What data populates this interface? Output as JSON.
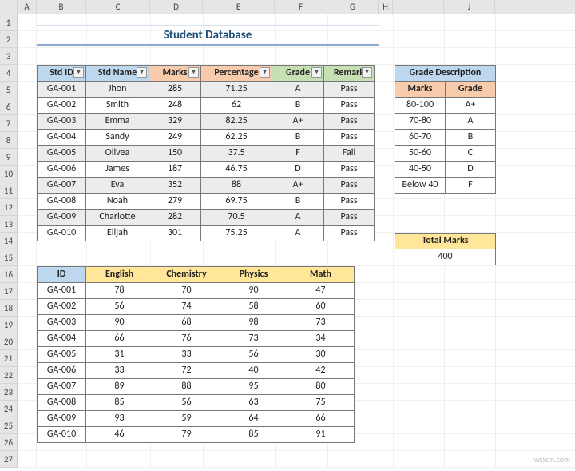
{
  "title": "Student Database",
  "columns_letters": [
    "A",
    "B",
    "C",
    "D",
    "E",
    "F",
    "G",
    "H",
    "I",
    "J"
  ],
  "main_table": {
    "headers": [
      "Std ID",
      "Std Name",
      "Marks",
      "Percentage",
      "Grade",
      "Remark"
    ],
    "rows": [
      {
        "id": "GA-001",
        "name": "Jhon",
        "marks": "285",
        "pct": "71.25",
        "grade": "A",
        "remark": "Pass"
      },
      {
        "id": "GA-002",
        "name": "Smith",
        "marks": "248",
        "pct": "62",
        "grade": "B",
        "remark": "Pass"
      },
      {
        "id": "GA-003",
        "name": "Emma",
        "marks": "329",
        "pct": "82.25",
        "grade": "A+",
        "remark": "Pass"
      },
      {
        "id": "GA-004",
        "name": "Sandy",
        "marks": "249",
        "pct": "62.25",
        "grade": "B",
        "remark": "Pass"
      },
      {
        "id": "GA-005",
        "name": "Olivea",
        "marks": "150",
        "pct": "37.5",
        "grade": "F",
        "remark": "Fail"
      },
      {
        "id": "GA-006",
        "name": "James",
        "marks": "187",
        "pct": "46.75",
        "grade": "D",
        "remark": "Pass"
      },
      {
        "id": "GA-007",
        "name": "Eva",
        "marks": "352",
        "pct": "88",
        "grade": "A+",
        "remark": "Pass"
      },
      {
        "id": "GA-008",
        "name": "Noah",
        "marks": "279",
        "pct": "69.75",
        "grade": "B",
        "remark": "Pass"
      },
      {
        "id": "GA-009",
        "name": "Charlotte",
        "marks": "282",
        "pct": "70.5",
        "grade": "A",
        "remark": "Pass"
      },
      {
        "id": "GA-010",
        "name": "Elijah",
        "marks": "301",
        "pct": "75.25",
        "grade": "A",
        "remark": "Pass"
      }
    ]
  },
  "grade_table": {
    "title": "Grade Description",
    "headers": [
      "Marks",
      "Grade"
    ],
    "rows": [
      {
        "m": "80-100",
        "g": "A+"
      },
      {
        "m": "70-80",
        "g": "A"
      },
      {
        "m": "60-70",
        "g": "B"
      },
      {
        "m": "50-60",
        "g": "C"
      },
      {
        "m": "40-50",
        "g": "D"
      },
      {
        "m": "Below 40",
        "g": "F"
      }
    ]
  },
  "total_marks": {
    "label": "Total Marks",
    "value": "400"
  },
  "subjects_table": {
    "headers": [
      "ID",
      "English",
      "Chemistry",
      "Physics",
      "Math"
    ],
    "rows": [
      {
        "id": "GA-001",
        "e": "78",
        "c": "70",
        "p": "90",
        "m": "47"
      },
      {
        "id": "GA-002",
        "e": "56",
        "c": "74",
        "p": "58",
        "m": "60"
      },
      {
        "id": "GA-003",
        "e": "90",
        "c": "68",
        "p": "98",
        "m": "73"
      },
      {
        "id": "GA-004",
        "e": "66",
        "c": "76",
        "p": "73",
        "m": "34"
      },
      {
        "id": "GA-005",
        "e": "31",
        "c": "33",
        "p": "56",
        "m": "30"
      },
      {
        "id": "GA-006",
        "e": "33",
        "c": "72",
        "p": "40",
        "m": "42"
      },
      {
        "id": "GA-007",
        "e": "89",
        "c": "88",
        "p": "95",
        "m": "80"
      },
      {
        "id": "GA-008",
        "e": "85",
        "c": "56",
        "p": "63",
        "m": "75"
      },
      {
        "id": "GA-009",
        "e": "93",
        "c": "59",
        "p": "64",
        "m": "66"
      },
      {
        "id": "GA-010",
        "e": "46",
        "c": "79",
        "p": "85",
        "m": "91"
      }
    ]
  },
  "watermark": "wsxdn.com"
}
